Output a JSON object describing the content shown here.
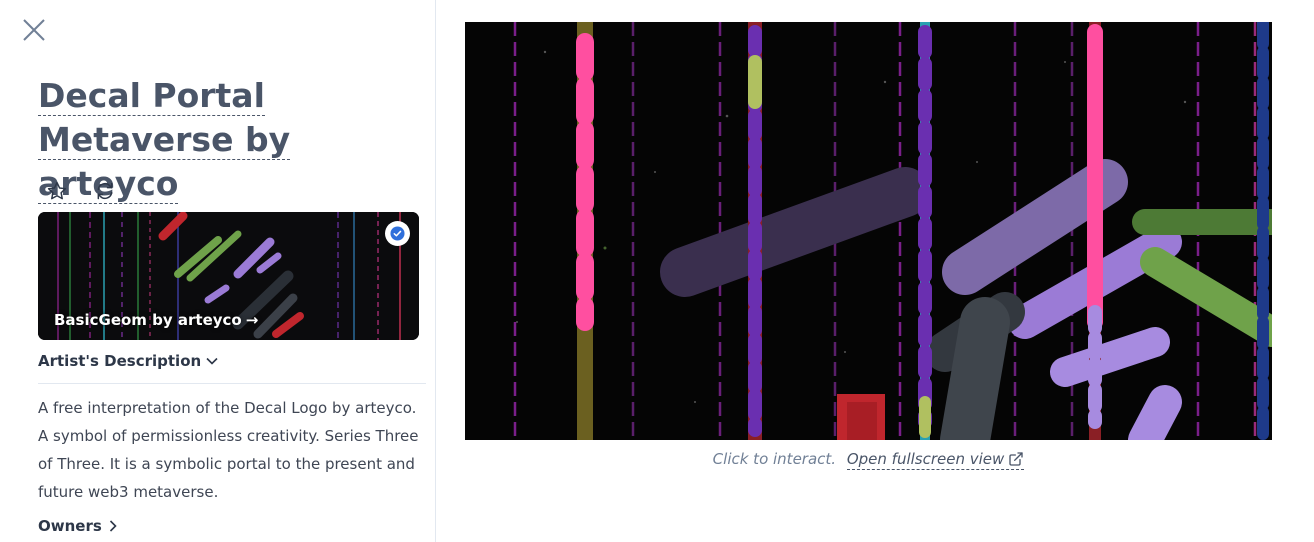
{
  "sidebar": {
    "close_icon": "close-icon",
    "title": "Decal Portal Metaverse by arteyco",
    "actions": {
      "favorite_icon": "star-icon",
      "refresh_icon": "refresh-icon"
    },
    "collection": {
      "label": "BasicGeom by arteyco",
      "arrow": "→",
      "verified_icon": "verified-check-icon"
    },
    "description_toggle": "Artist's Description",
    "description": "A free interpretation of the Decal Logo by arteyco. A symbol of permissionless creativity. Series Three of Three. It is a symbolic portal to the present and future web3 metaverse.",
    "owners_label": "Owners"
  },
  "preview": {
    "hint": "Click to interact.",
    "fullscreen_label": "Open fullscreen view",
    "fullscreen_icon": "external-link-icon"
  },
  "colors": {
    "title": "#4a5568",
    "pink": "#ff4fa0",
    "purple": "#9b7bd6",
    "green": "#6fa24a",
    "red": "#c0262d",
    "blue": "#1e3a8a"
  }
}
